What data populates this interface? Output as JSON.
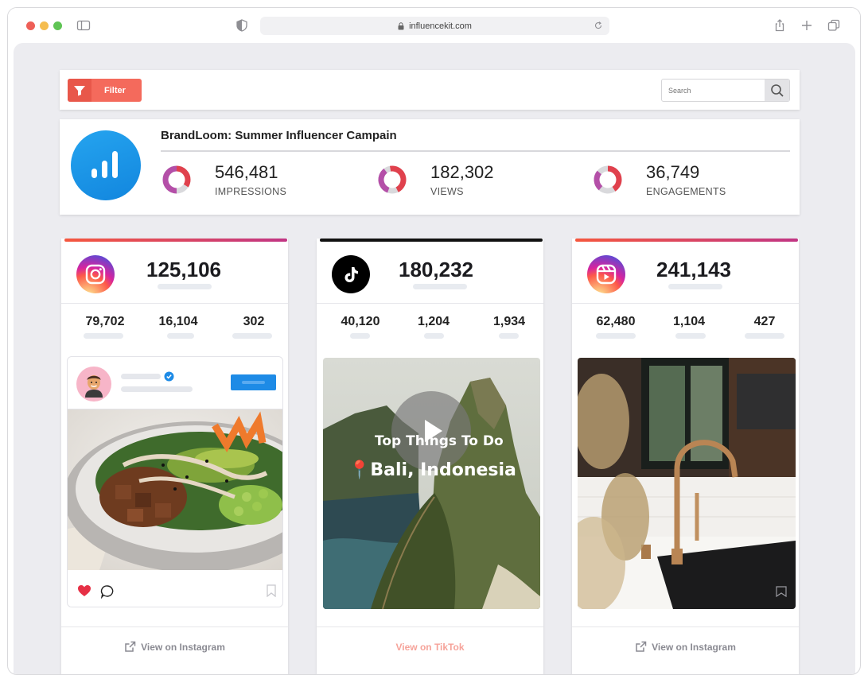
{
  "browser": {
    "url": "influencekit.com"
  },
  "toolbar": {
    "filter_label": "Filter",
    "search_placeholder": "Search"
  },
  "campaign": {
    "title": "BrandLoom: Summer Influencer Campain",
    "stats": [
      {
        "value": "546,481",
        "label": "IMPRESSIONS"
      },
      {
        "value": "182,302",
        "label": "VIEWS"
      },
      {
        "value": "36,749",
        "label": "ENGAGEMENTS"
      }
    ]
  },
  "cards": [
    {
      "platform": "instagram",
      "icon": "instagram-icon",
      "total": "125,106",
      "metrics": [
        "79,702",
        "16,104",
        "302"
      ],
      "footer": "View on Instagram"
    },
    {
      "platform": "tiktok",
      "icon": "tiktok-icon",
      "total": "180,232",
      "metrics": [
        "40,120",
        "1,204",
        "1,934"
      ],
      "video_overlay_top": "Top Things To Do",
      "video_overlay_location": "Bali, Indonesia",
      "footer": "View on TikTok"
    },
    {
      "platform": "instagram-reels",
      "icon": "instagram-reels-icon",
      "total": "241,143",
      "metrics": [
        "62,480",
        "1,104",
        "427"
      ],
      "footer": "View on Instagram"
    }
  ],
  "colors": {
    "accent_red": "#f46a5c",
    "brand_blue": "#1e8be6",
    "instagram_gradient": [
      "#f56040",
      "#c13584"
    ],
    "tiktok": "#000000"
  }
}
